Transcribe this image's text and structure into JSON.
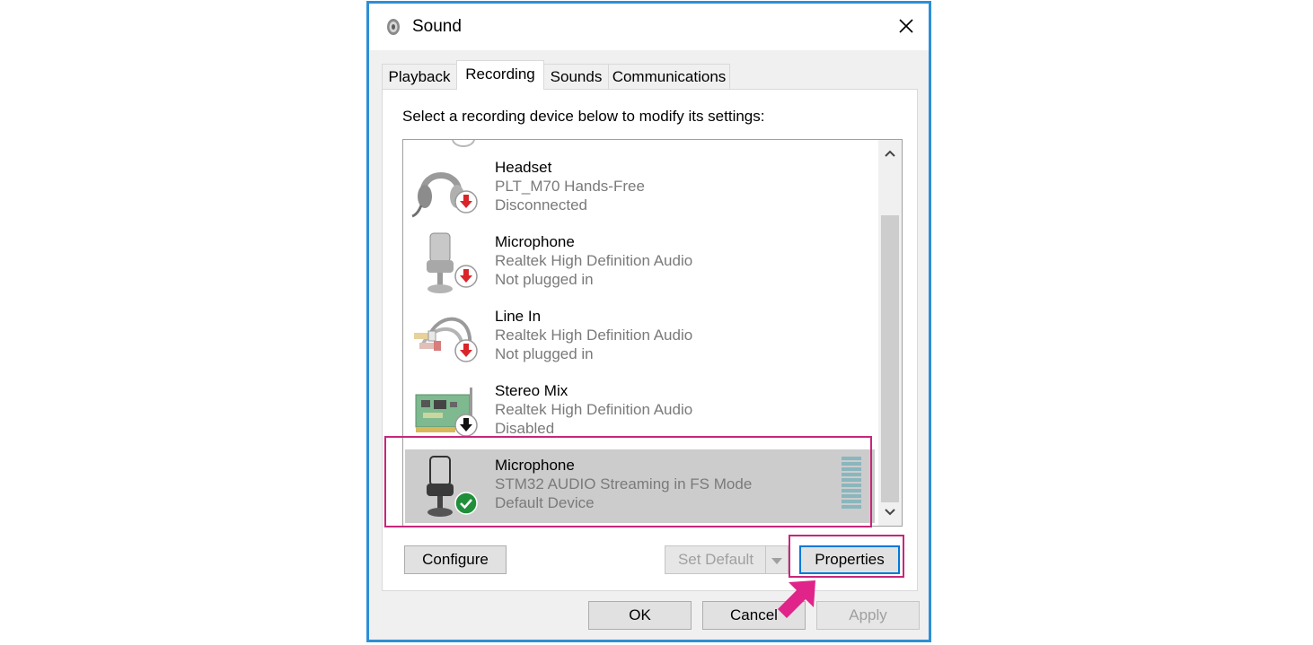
{
  "window": {
    "title": "Sound",
    "icon": "speaker-icon",
    "close_icon": "close-icon"
  },
  "tabs": [
    {
      "label": "Playback",
      "active": false
    },
    {
      "label": "Recording",
      "active": true
    },
    {
      "label": "Sounds",
      "active": false
    },
    {
      "label": "Communications",
      "active": false
    }
  ],
  "recording": {
    "instruction": "Select a recording device below to modify its settings:",
    "devices": [
      {
        "name": "Headset",
        "description": "PLT_M70 Hands-Free",
        "status": "Disconnected",
        "icon": "headset-icon",
        "badge": "red-down-arrow-badge"
      },
      {
        "name": "Microphone",
        "description": "Realtek High Definition Audio",
        "status": "Not plugged in",
        "icon": "microphone-icon",
        "badge": "red-down-arrow-badge"
      },
      {
        "name": "Line In",
        "description": "Realtek High Definition Audio",
        "status": "Not plugged in",
        "icon": "line-in-cable-icon",
        "badge": "red-down-arrow-badge"
      },
      {
        "name": "Stereo Mix",
        "description": "Realtek High Definition Audio",
        "status": "Disabled",
        "icon": "sound-card-icon",
        "badge": "black-down-arrow-badge"
      },
      {
        "name": "Microphone",
        "description": "STM32 AUDIO Streaming in FS Mode",
        "status": "Default Device",
        "icon": "microphone-icon",
        "badge": "green-check-badge",
        "selected": true
      }
    ]
  },
  "buttons": {
    "configure": "Configure",
    "set_default": "Set Default",
    "properties": "Properties",
    "ok": "OK",
    "cancel": "Cancel",
    "apply": "Apply"
  },
  "colors": {
    "window_border": "#2d8fd6",
    "highlight": "#c8267c",
    "selection": "#cccccc",
    "status_red": "#d9252a",
    "status_green": "#1f8f3a"
  }
}
